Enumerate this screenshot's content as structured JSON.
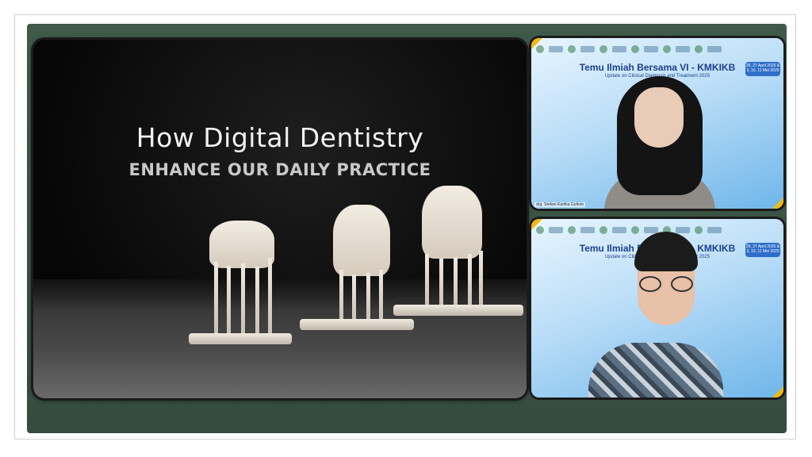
{
  "presentation": {
    "title": "How Digital Dentistry",
    "subtitle": "ENHANCE OUR DAILY PRACTICE"
  },
  "participants": [
    {
      "banner_title": "Temu Ilmiah Bersama VI - KMKIKB",
      "banner_subtitle": "Update on Clinical Diagnosis and Treatment 2025",
      "date_badge": "26, 27 April 2025 & 3, 10, 11 Mei 2025",
      "name": "drg. Stefani Kartika Gultom"
    },
    {
      "banner_title": "Temu Ilmiah Bersama VI - KMKIKB",
      "banner_subtitle": "Update on Clinical Diagnosis and Treatment 2025",
      "date_badge": "26, 27 April 2025 & 3, 10, 11 Mei 2025"
    }
  ],
  "colors": {
    "stage_bg": "#3f5a48",
    "banner_blue": "#1d3f8a",
    "accent_yellow": "#f2b90d"
  }
}
